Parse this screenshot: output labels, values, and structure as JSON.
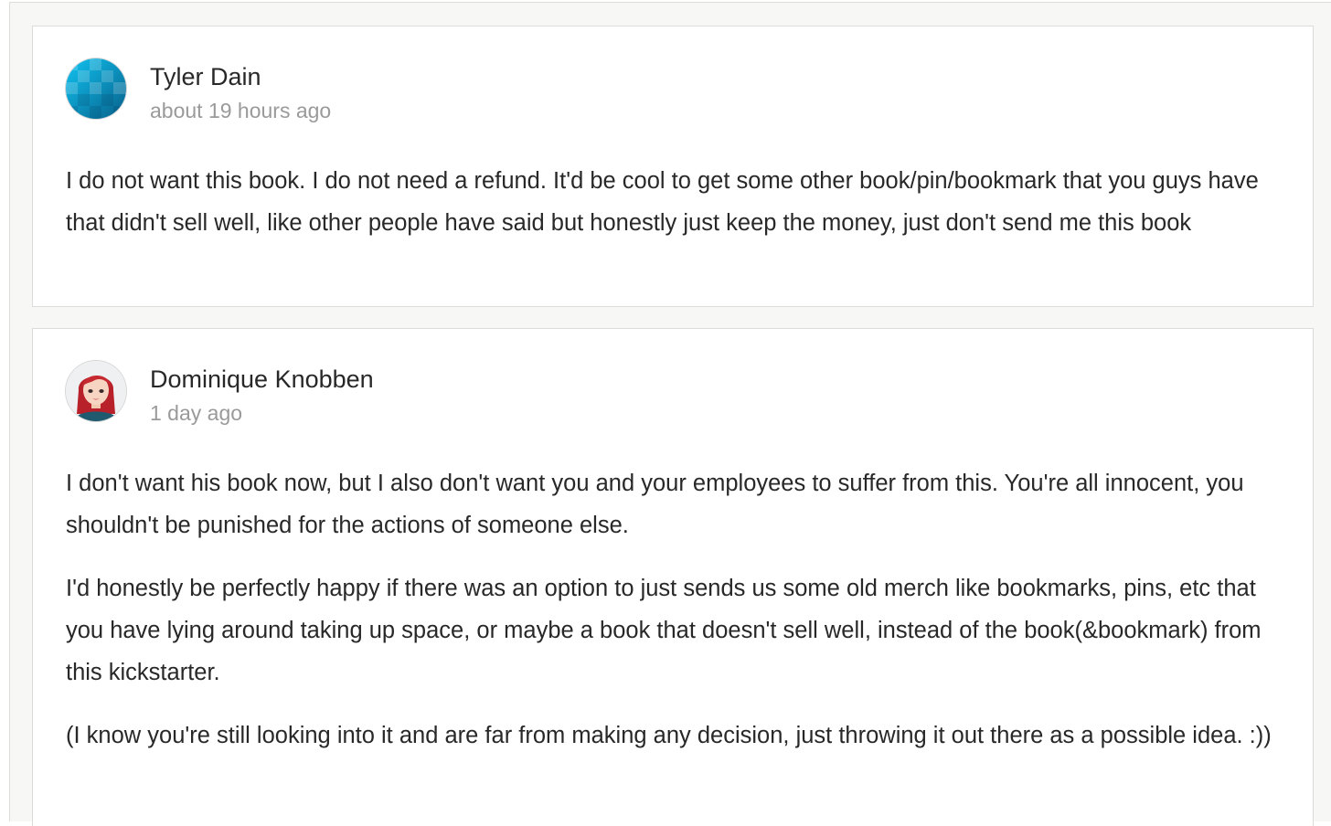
{
  "comments": [
    {
      "author": "Tyler Dain",
      "timestamp": "about 19 hours ago",
      "avatar_icon": "blue-gradient-avatar-icon",
      "avatar_colors": [
        "#0bb3e6",
        "#0a6d98"
      ],
      "paragraphs": [
        "I do not want this book. I do not need a refund. It'd be cool to get some other book/pin/bookmark that you guys have that didn't sell well, like other people have said but honestly just keep the money, just don't send me this book"
      ]
    },
    {
      "author": "Dominique Knobben",
      "timestamp": "1 day ago",
      "avatar_icon": "red-haired-woman-avatar-icon",
      "avatar_colors": [
        "#c0282a",
        "#f4d2bd"
      ],
      "paragraphs": [
        "I don't want his book now, but I also don't want you and your employees to suffer from this. You're all innocent, you shouldn't be punished for the actions of someone else.",
        "I'd honestly be perfectly happy if there was an option to just sends us some old merch like bookmarks, pins, etc that you have lying around taking up space, or maybe a book that doesn't sell well, instead of the book(&bookmark) from this kickstarter.",
        "(I know you're still looking into it and are far from making any decision, just throwing it out there as a possible idea. :))"
      ]
    }
  ]
}
